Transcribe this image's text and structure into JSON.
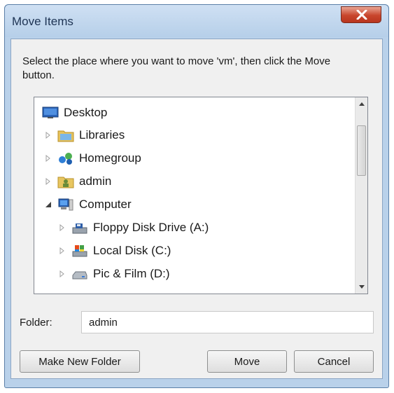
{
  "dialog": {
    "title": "Move Items",
    "instruction": "Select the place where you want to move 'vm', then click the Move button.",
    "folder_label": "Folder:",
    "folder_value": "admin",
    "buttons": {
      "make_new_folder": "Make New Folder",
      "move": "Move",
      "cancel": "Cancel"
    }
  },
  "tree": {
    "items": [
      {
        "label": "Desktop",
        "icon": "desktop-icon"
      },
      {
        "label": "Libraries",
        "icon": "libraries-icon"
      },
      {
        "label": "Homegroup",
        "icon": "homegroup-icon"
      },
      {
        "label": "admin",
        "icon": "user-folder-icon"
      },
      {
        "label": "Computer",
        "icon": "computer-icon"
      },
      {
        "label": "Floppy Disk Drive (A:)",
        "icon": "floppy-drive-icon"
      },
      {
        "label": "Local Disk (C:)",
        "icon": "local-disk-icon"
      },
      {
        "label": "Pic & Film (D:)",
        "icon": "drive-icon"
      }
    ]
  },
  "colors": {
    "titlebar": "#b9d1ea",
    "close_button": "#c8452c",
    "dialog_body": "#f0f0f0"
  }
}
